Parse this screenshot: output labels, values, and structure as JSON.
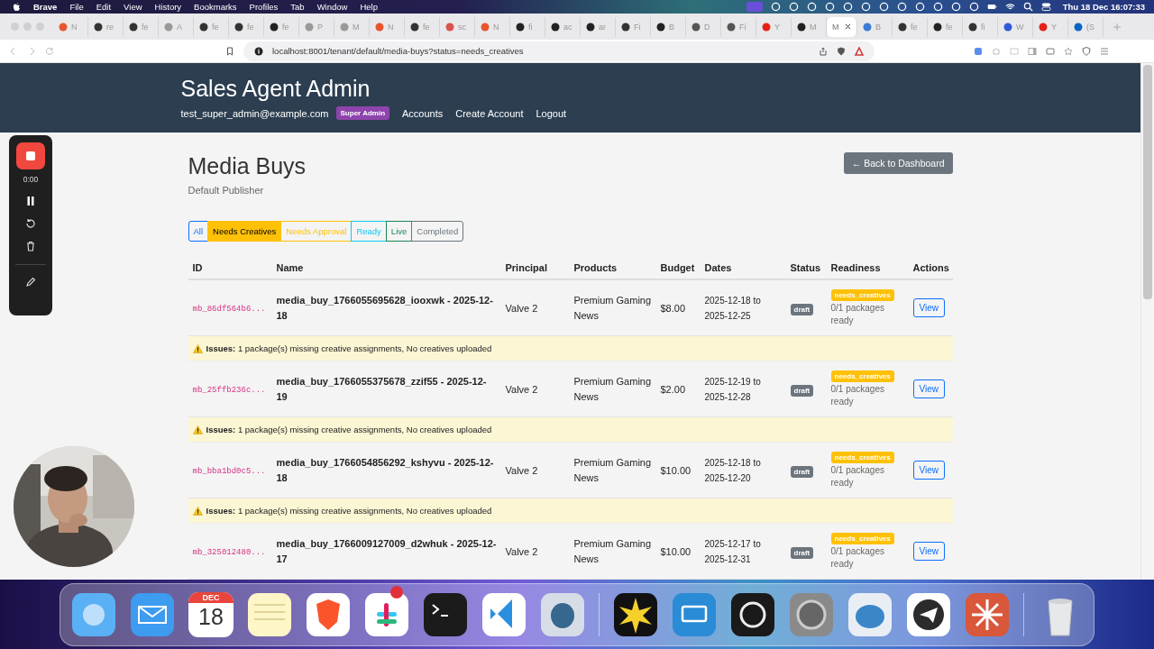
{
  "menu_bar": {
    "app": "Brave",
    "menus": [
      "File",
      "Edit",
      "View",
      "History",
      "Bookmarks",
      "Profiles",
      "Tab",
      "Window",
      "Help"
    ],
    "clock": "Thu 18 Dec  16:07:33"
  },
  "browser": {
    "tabs": [
      {
        "label": "N",
        "selected": false
      },
      {
        "label": "re",
        "selected": false
      },
      {
        "label": "fe",
        "selected": false
      },
      {
        "label": "A",
        "selected": false
      },
      {
        "label": "fe",
        "selected": false
      },
      {
        "label": "fe",
        "selected": false
      },
      {
        "label": "fe",
        "selected": false
      },
      {
        "label": "P",
        "selected": false
      },
      {
        "label": "M",
        "selected": false
      },
      {
        "label": "N",
        "selected": false
      },
      {
        "label": "fe",
        "selected": false
      },
      {
        "label": "sc",
        "selected": false
      },
      {
        "label": "N",
        "selected": false
      },
      {
        "label": "fi",
        "selected": false
      },
      {
        "label": "ac",
        "selected": false
      },
      {
        "label": "ar",
        "selected": false
      },
      {
        "label": "Fi",
        "selected": false
      },
      {
        "label": "B",
        "selected": false
      },
      {
        "label": "D",
        "selected": false
      },
      {
        "label": "Fi",
        "selected": false
      },
      {
        "label": "Y",
        "selected": false
      },
      {
        "label": "M",
        "selected": false
      },
      {
        "label": "M",
        "selected": true
      },
      {
        "label": "B",
        "selected": false
      },
      {
        "label": "fe",
        "selected": false
      },
      {
        "label": "fe",
        "selected": false
      },
      {
        "label": "fi",
        "selected": false
      },
      {
        "label": "W",
        "selected": false
      },
      {
        "label": "Y",
        "selected": false
      },
      {
        "label": "(S",
        "selected": false
      }
    ],
    "url": "localhost:8001/tenant/default/media-buys?status=needs_creatives"
  },
  "header": {
    "title": "Sales Agent Admin",
    "user": "test_super_admin@example.com",
    "role_badge": "Super Admin",
    "nav": [
      "Accounts",
      "Create Account",
      "Logout"
    ]
  },
  "page": {
    "title": "Media Buys",
    "subtitle": "Default Publisher",
    "back_button": "← Back to Dashboard"
  },
  "filters": [
    {
      "label": "All",
      "kind": "primary",
      "selected": false
    },
    {
      "label": "Needs Creatives",
      "kind": "warning",
      "selected": true
    },
    {
      "label": "Needs Approval",
      "kind": "warning",
      "selected": false
    },
    {
      "label": "Ready",
      "kind": "info",
      "selected": false
    },
    {
      "label": "Live",
      "kind": "success",
      "selected": false
    },
    {
      "label": "Completed",
      "kind": "secondary",
      "selected": false
    }
  ],
  "table": {
    "columns": [
      "ID",
      "Name",
      "Principal",
      "Products",
      "Budget",
      "Dates",
      "Status",
      "Readiness",
      "Actions"
    ],
    "rows": [
      {
        "id": "mb_86df564b6...",
        "name": "media_buy_1766055695628_iooxwk - 2025-12-18",
        "principal": "Valve 2",
        "products": "Premium Gaming News",
        "budget": "$8.00",
        "dates": "2025-12-18 to 2025-12-25",
        "status": "draft",
        "readiness": "needs_creatives",
        "readiness_note": "0/1 packages ready",
        "action": "View",
        "issues": "**Issues:** 1 package(s) missing creative assignments, No creatives uploaded"
      },
      {
        "id": "mb_25ffb236c...",
        "name": "media_buy_1766055375678_zzif55 - 2025-12-19",
        "principal": "Valve 2",
        "products": "Premium Gaming News",
        "budget": "$2.00",
        "dates": "2025-12-19 to 2025-12-28",
        "status": "draft",
        "readiness": "needs_creatives",
        "readiness_note": "0/1 packages ready",
        "action": "View",
        "issues": "**Issues:** 1 package(s) missing creative assignments, No creatives uploaded"
      },
      {
        "id": "mb_bba1bd0c5...",
        "name": "media_buy_1766054856292_kshyvu - 2025-12-18",
        "principal": "Valve 2",
        "products": "Premium Gaming News",
        "budget": "$10.00",
        "dates": "2025-12-18 to 2025-12-20",
        "status": "draft",
        "readiness": "needs_creatives",
        "readiness_note": "0/1 packages ready",
        "action": "View",
        "issues": "**Issues:** 1 package(s) missing creative assignments, No creatives uploaded"
      },
      {
        "id": "mb_325012480...",
        "name": "media_buy_1766009127009_d2whuk - 2025-12-17",
        "principal": "Valve 2",
        "products": "Premium Gaming News",
        "budget": "$10.00",
        "dates": "2025-12-17 to 2025-12-31",
        "status": "draft",
        "readiness": "needs_creatives",
        "readiness_note": "0/1 packages ready",
        "action": "View"
      }
    ]
  },
  "recorder": {
    "time": "0:00"
  },
  "dock": {
    "calendar_month": "DEC",
    "calendar_day": "18"
  }
}
